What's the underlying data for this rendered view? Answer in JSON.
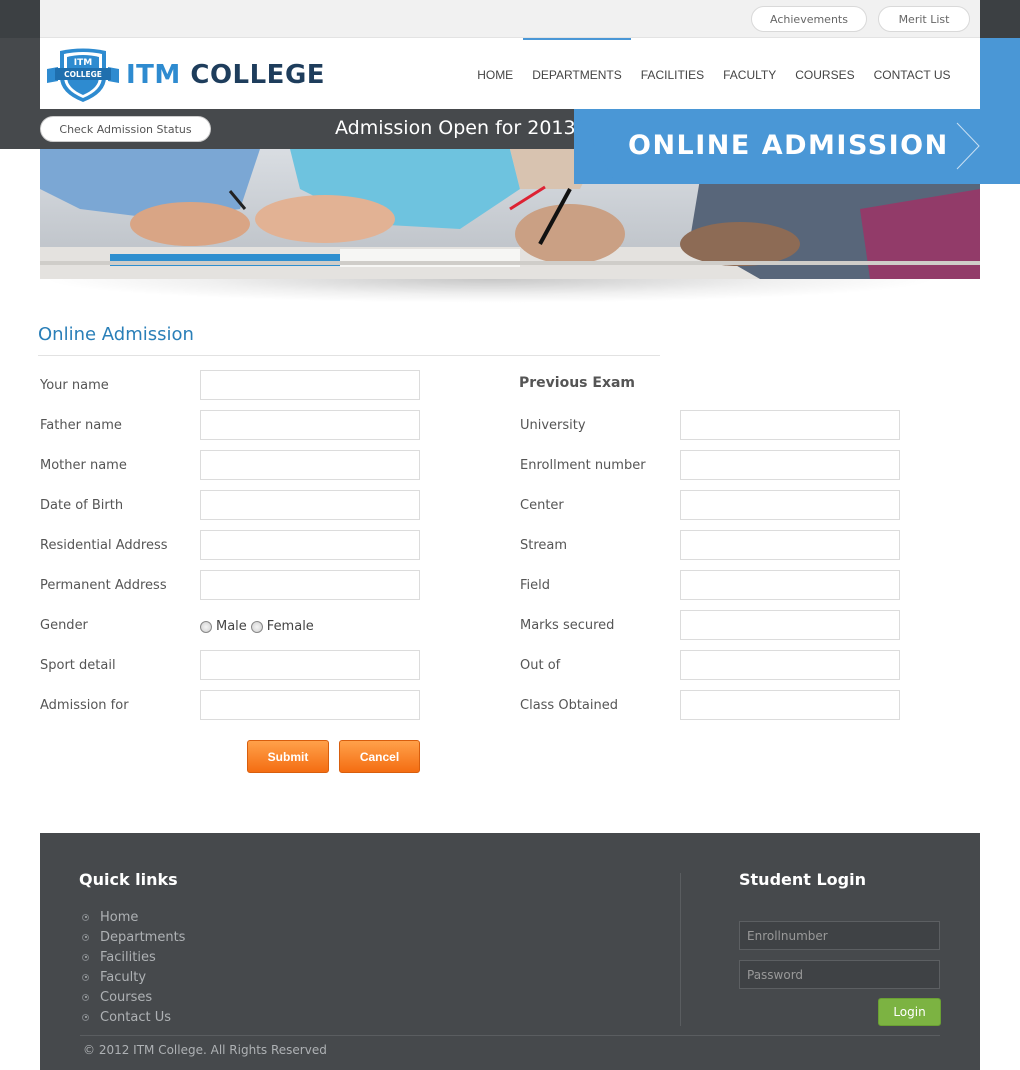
{
  "topbar": {
    "achievements": "Achievements",
    "merit_list": "Merit List"
  },
  "logo": {
    "badge_top": "ITM",
    "badge_bottom": "COLLEGE",
    "name_part1": "ITM",
    "name_part2": "COLLEGE"
  },
  "nav": {
    "items": [
      "HOME",
      "DEPARTMENTS",
      "FACILITIES",
      "FACULTY",
      "COURSES",
      "CONTACT US"
    ],
    "active": "DEPARTMENTS"
  },
  "strip": {
    "check_status": "Check Admission Status",
    "admission_open": "Admission Open for 2013",
    "online_admission": "ONLINE ADMISSION"
  },
  "form": {
    "title": "Online Admission",
    "left_fields": [
      "Your name",
      "Father name",
      "Mother name",
      "Date of Birth",
      "Residential Address",
      "Permanent Address",
      "Gender",
      "Sport detail",
      "Admission for"
    ],
    "gender_options": [
      "Male",
      "Female"
    ],
    "right_heading": "Previous Exam",
    "right_fields": [
      "University",
      "Enrollment number",
      "Center",
      "Stream",
      "Field",
      "Marks secured",
      "Out of",
      "Class Obtained"
    ],
    "submit": "Submit",
    "cancel": "Cancel"
  },
  "footer": {
    "quick_links_title": "Quick links",
    "quick_links": [
      "Home",
      "Departments",
      "Facilities",
      "Faculty",
      "Courses",
      "Contact Us"
    ],
    "student_login_title": "Student Login",
    "enroll_placeholder": "Enrollnumber",
    "password_placeholder": "Password",
    "login": "Login",
    "copyright": "© 2012 ITM College. All Rights Reserved"
  },
  "colors": {
    "accent_blue": "#4a97d6",
    "title_blue": "#2a7fb8",
    "orange": "#f46d12",
    "green": "#7cb342",
    "dark": "#46494c"
  }
}
